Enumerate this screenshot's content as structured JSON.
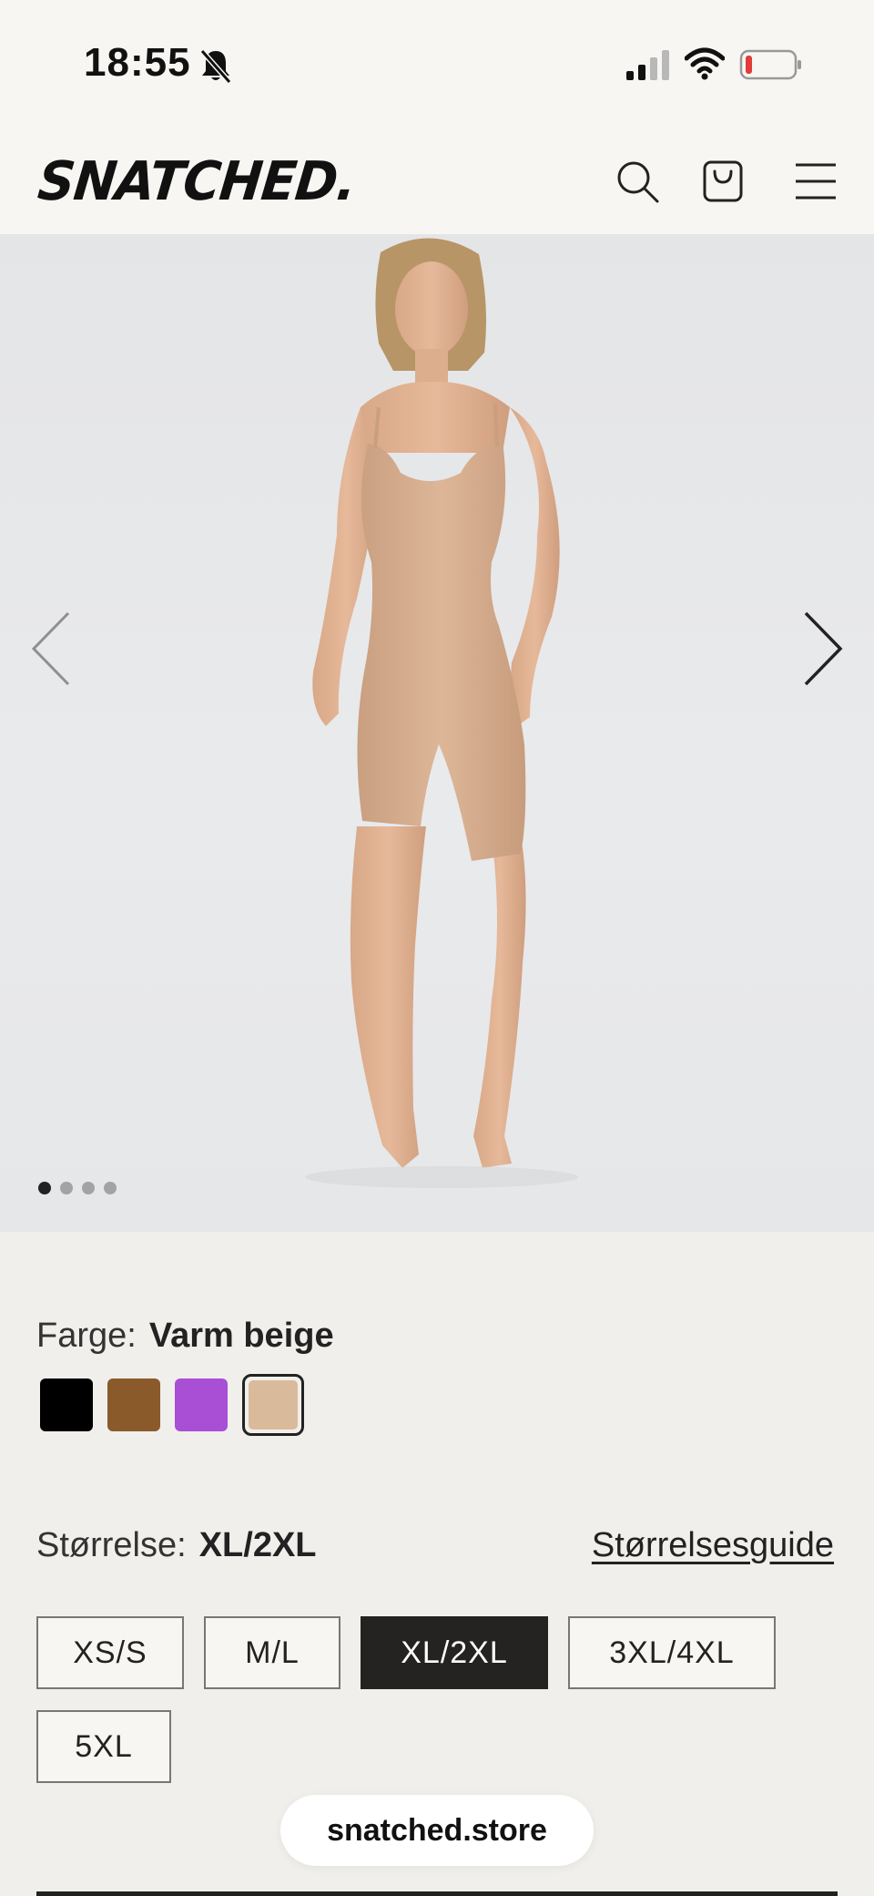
{
  "status_bar": {
    "time": "18:55",
    "icons": [
      "bell-slash-icon",
      "signal-icon",
      "wifi-icon",
      "battery-icon"
    ]
  },
  "header": {
    "logo": "SNATCHED.",
    "icons": [
      "search-icon",
      "shopping-bag-icon",
      "hamburger-menu-icon"
    ]
  },
  "gallery": {
    "image_count": 4,
    "active_index": 0,
    "prev_icon": "chevron-left-icon",
    "next_icon": "chevron-right-icon"
  },
  "color": {
    "label": "Farge:",
    "value": "Varm beige",
    "swatches": [
      {
        "color": "#000000"
      },
      {
        "color": "#8a5a2b"
      },
      {
        "color": "#a84fd6"
      },
      {
        "color": "#d9bb9b",
        "selected": true
      }
    ]
  },
  "size": {
    "label": "Størrelse:",
    "value": "XL/2XL",
    "guide_link": "Størrelsesguide",
    "options": [
      "XS/S",
      "M/L",
      "XL/2XL",
      "3XL/4XL",
      "5XL"
    ],
    "selected": "XL/2XL"
  },
  "browser": {
    "url": "snatched.store"
  },
  "colors": {
    "background": "#f1efeb",
    "header_bg": "#f8f6f2",
    "selected_size_bg": "#242321",
    "product_beige": "#d9bb9b"
  }
}
